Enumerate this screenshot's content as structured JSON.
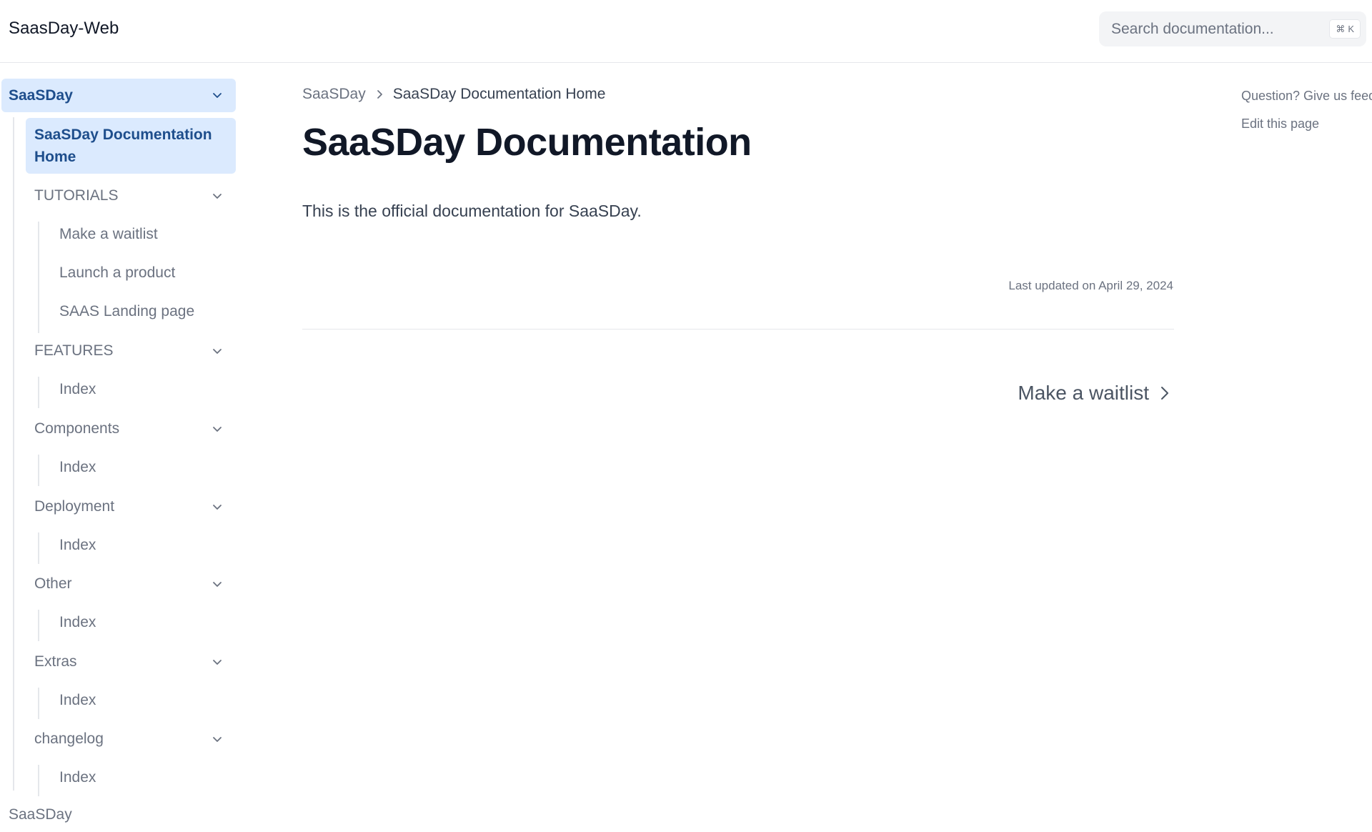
{
  "header": {
    "site_title": "SaasDay-Web",
    "search_placeholder": "Search documentation...",
    "search_shortcut_symbol": "⌘",
    "search_shortcut_key": "K"
  },
  "sidebar": {
    "root_label": "SaaSDay",
    "active_label_line1": "SaaSDay Documentation",
    "active_label_line2": "Home",
    "sections": [
      {
        "label": "TUTORIALS",
        "items": [
          "Make a waitlist",
          "Launch a product",
          "SAAS Landing page"
        ]
      },
      {
        "label": "FEATURES",
        "items": [
          "Index"
        ]
      },
      {
        "label": "Components",
        "items": [
          "Index"
        ]
      },
      {
        "label": "Deployment",
        "items": [
          "Index"
        ]
      },
      {
        "label": "Other",
        "items": [
          "Index"
        ]
      },
      {
        "label": "Extras",
        "items": [
          "Index"
        ]
      },
      {
        "label": "changelog",
        "items": [
          "Index"
        ]
      }
    ],
    "footer_label": "SaaSDay"
  },
  "main": {
    "breadcrumb": {
      "parent": "SaaSDay",
      "current": "SaaSDay Documentation Home"
    },
    "title": "SaaSDay Documentation",
    "intro": "This is the official documentation for SaaSDay.",
    "last_updated": "Last updated on April 29, 2024",
    "next_link": "Make a waitlist"
  },
  "aside": {
    "feedback": "Question? Give us feedback",
    "edit": "Edit this page"
  },
  "colors": {
    "accent_bg": "#dbeafe",
    "accent_text": "#1e4e8c",
    "title": "#111827",
    "muted": "#6b7280"
  }
}
